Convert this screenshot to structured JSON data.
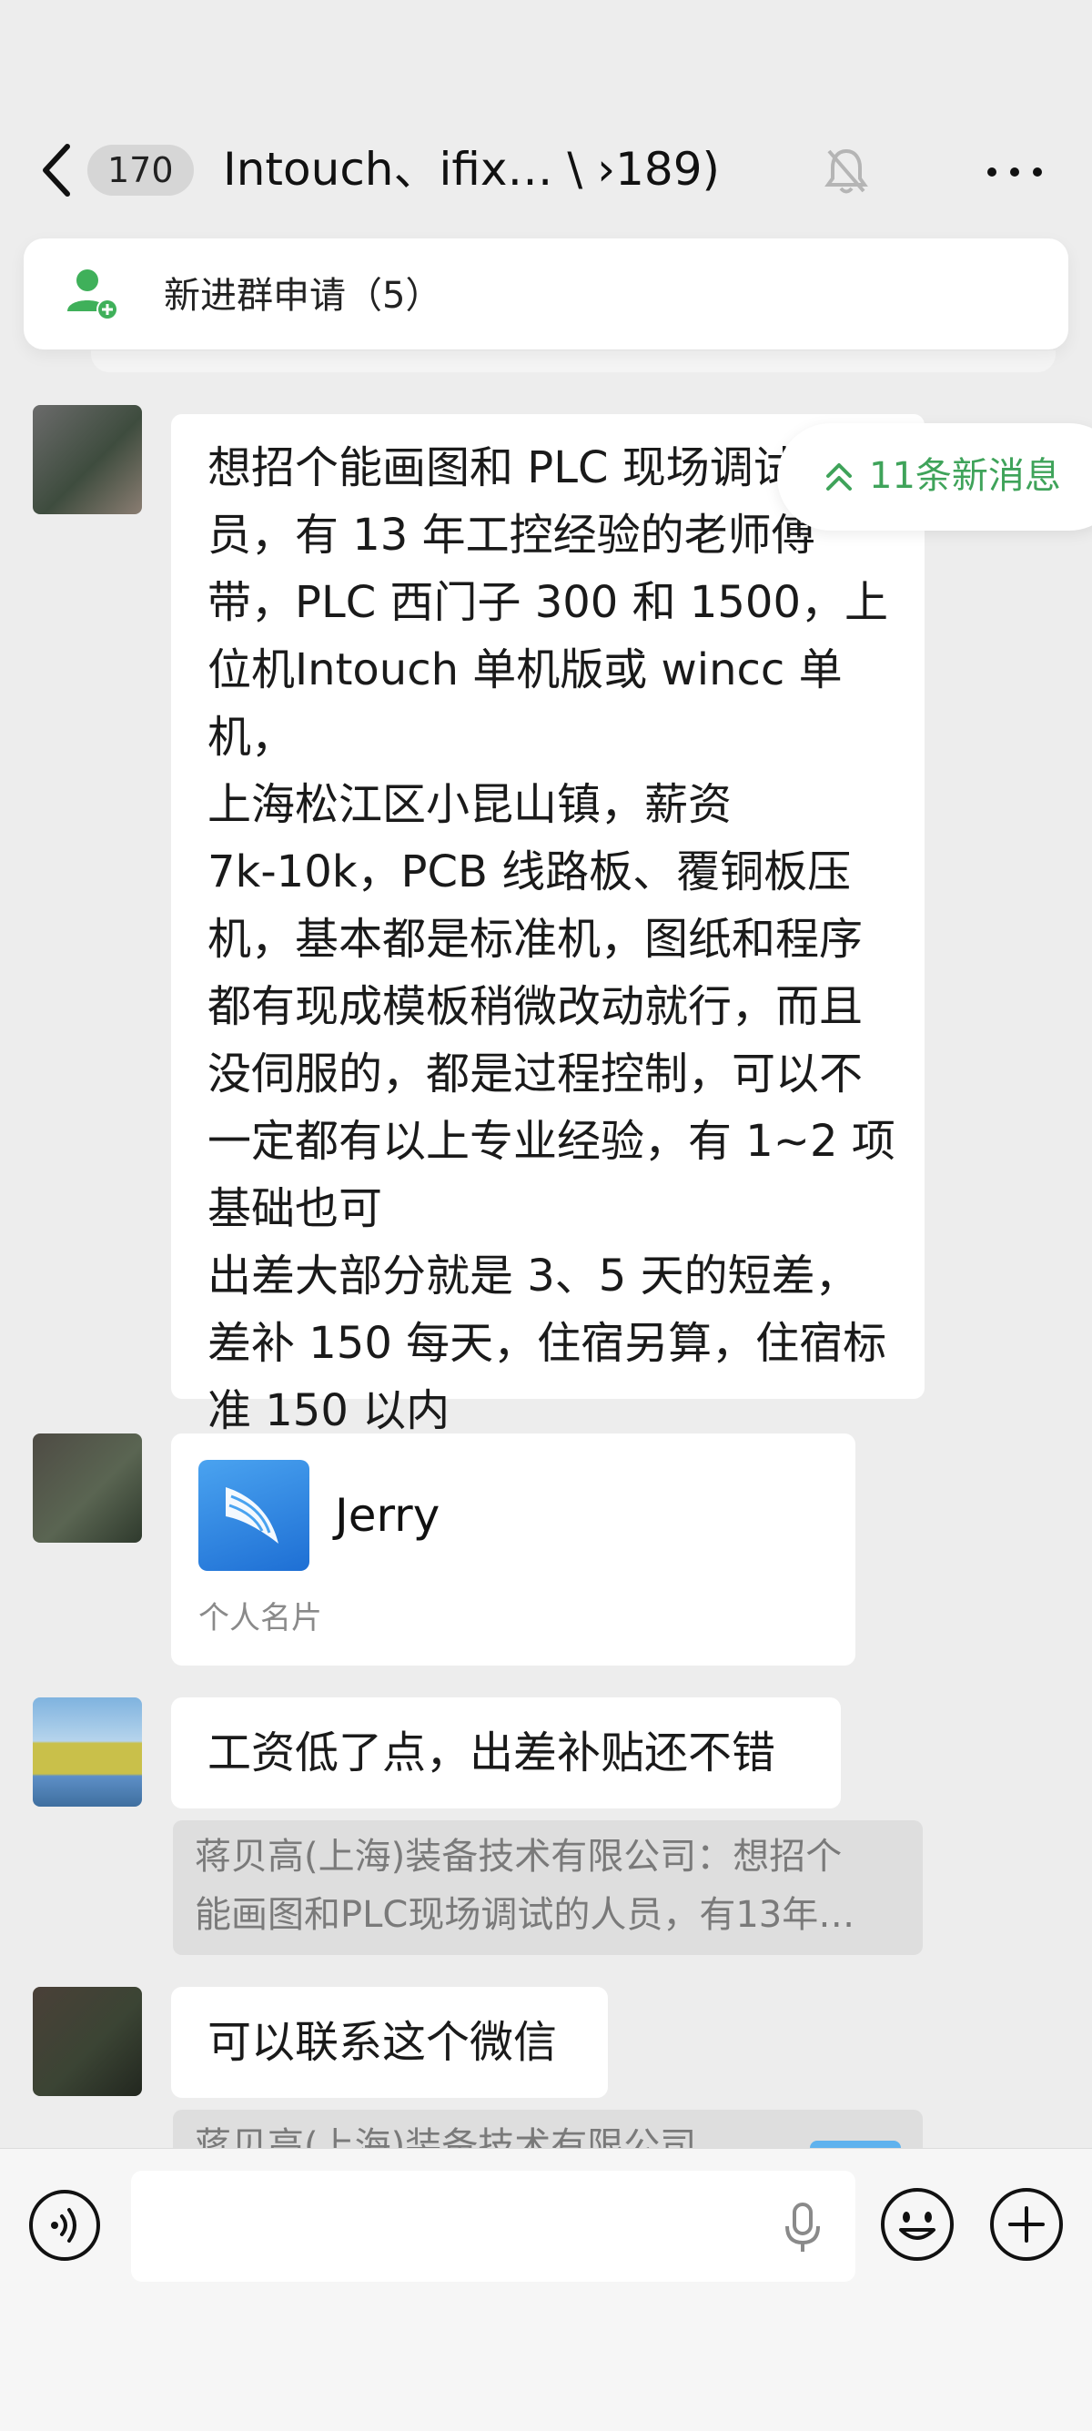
{
  "header": {
    "back_badge": "170",
    "title": "Intouch、ifix… \\ ›189)",
    "icons": {
      "back": "chevron-left-icon",
      "mute": "bell-muted-icon",
      "more": "ellipsis-icon"
    }
  },
  "join_request": {
    "label": "新进群申请（5）",
    "icon": "person-add-icon",
    "accent": "#3fb05a"
  },
  "new_messages": {
    "label": "11条新消息",
    "icon": "double-chevron-up-icon",
    "color": "#3fa35a"
  },
  "messages": [
    {
      "type": "text",
      "text": "想招个能画图和 PLC 现场调试人\n员，有 13 年工控经验的老师傅\n带，PLC 西门子 300 和 1500，上\n位机Intouch 单机版或 wincc 单机，\n上海松江区小昆山镇，薪资\n7k-10k，PCB 线路板、覆铜板压\n机，基本都是标准机，图纸和程序\n都有现成模板稍微改动就行，而且\n没伺服的，都是过程控制，可以不\n一定都有以上专业经验，有 1~2 项\n基础也可\n出差大部分就是 3、5 天的短差，\n差补 150 每天，住宿另算，住宿标\n准 150 以内"
    },
    {
      "type": "contact_card",
      "name": "Jerry",
      "label": "个人名片"
    },
    {
      "type": "text",
      "text": "工资低了点，出差补贴还不错",
      "quote": "蒋贝高(上海)装备技术有限公司：想招个\n能画图和PLC现场调试的人员，有13年…"
    },
    {
      "type": "text",
      "text": "可以联系这个微信",
      "quote": "蒋贝高(上海)装备技术有限公司..."
    }
  ],
  "input_bar": {
    "placeholder": "",
    "icons": {
      "voice": "voice-icon",
      "mic": "microphone-icon",
      "emoji": "emoji-icon",
      "more": "plus-circle-icon"
    }
  }
}
